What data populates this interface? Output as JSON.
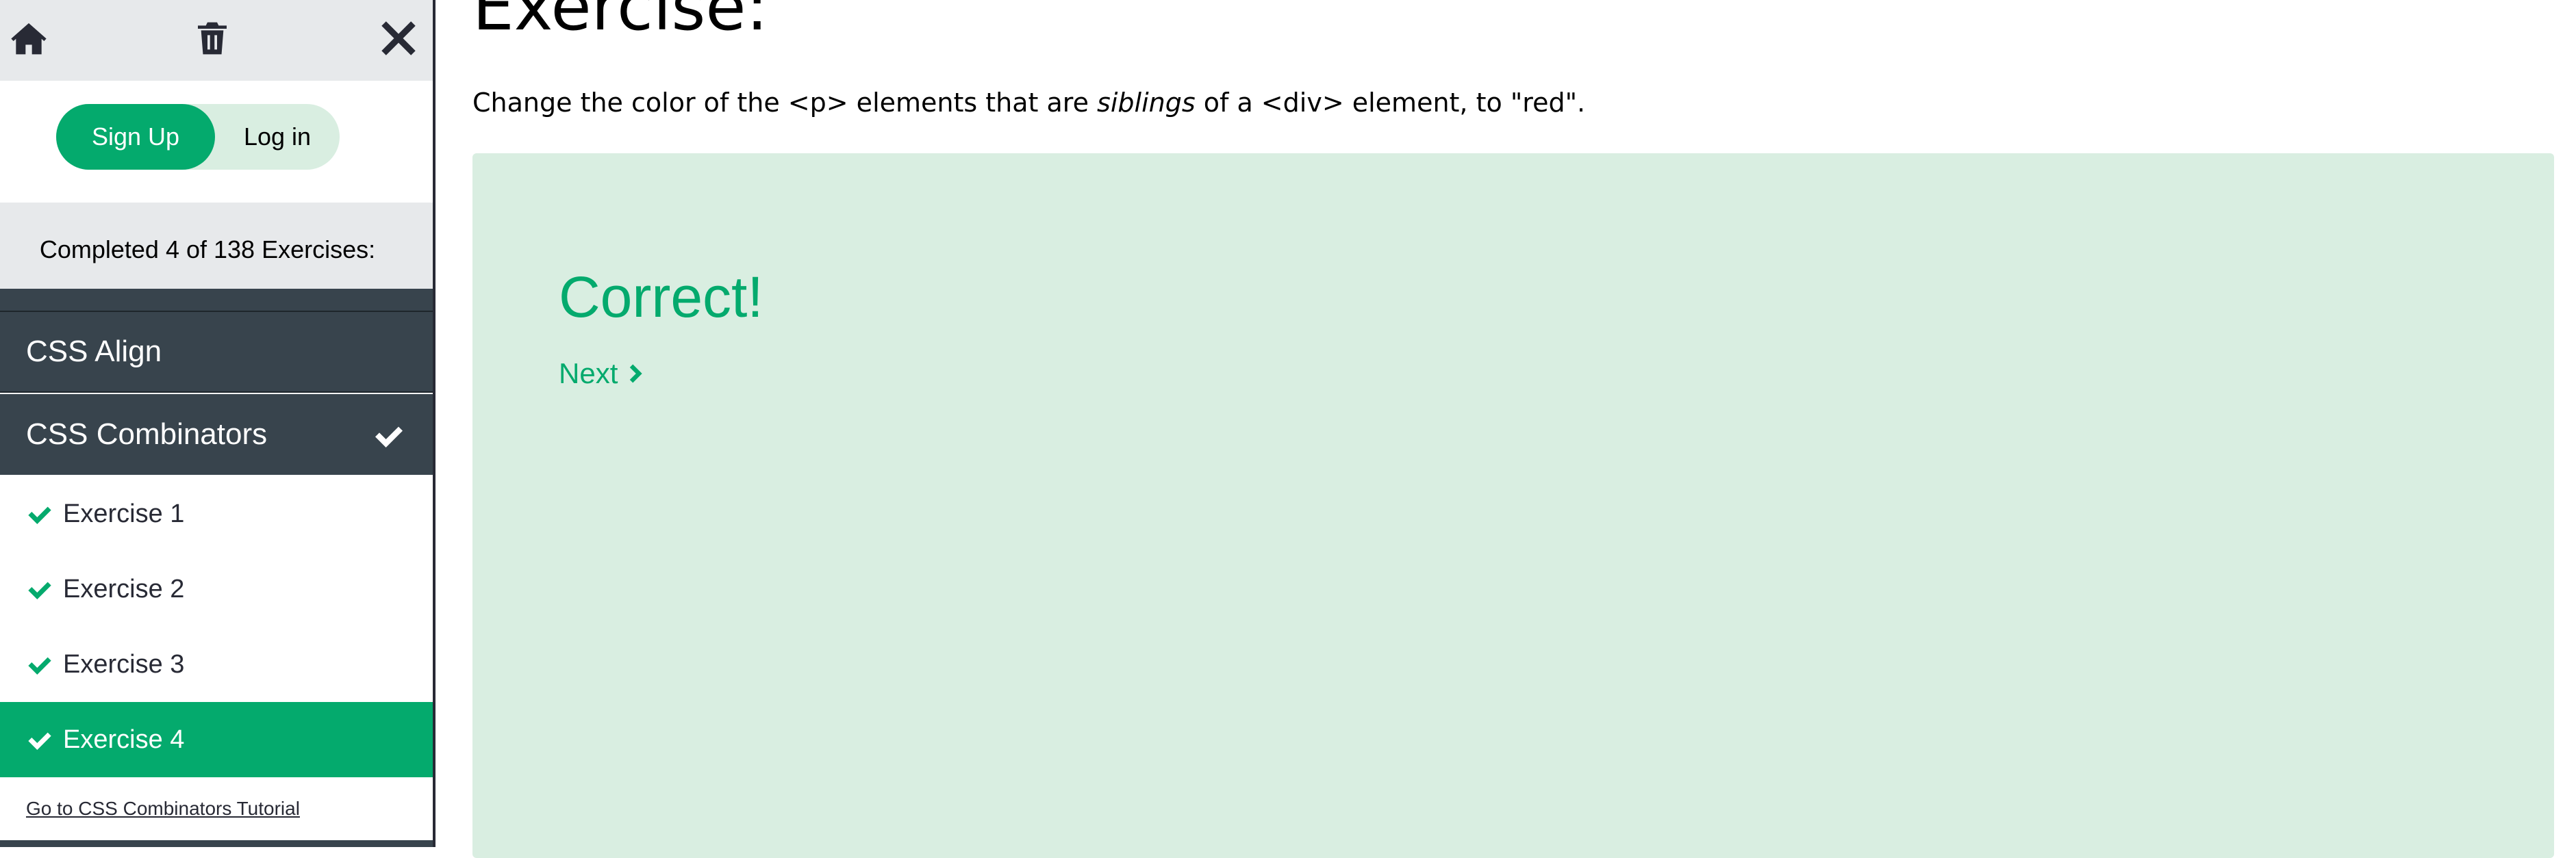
{
  "sidebar": {
    "icons": {
      "home": "home-icon",
      "trash": "trash-icon",
      "close": "close-icon"
    },
    "auth": {
      "signup_label": "Sign Up",
      "login_label": "Log in"
    },
    "progress_text": "Completed 4 of 138 Exercises:",
    "categories": [
      {
        "label": "CSS Align",
        "completed": false
      },
      {
        "label": "CSS Combinators",
        "completed": true
      }
    ],
    "exercises": [
      {
        "label": "Exercise 1",
        "completed": true,
        "active": false
      },
      {
        "label": "Exercise 2",
        "completed": true,
        "active": false
      },
      {
        "label": "Exercise 3",
        "completed": true,
        "active": false
      },
      {
        "label": "Exercise 4",
        "completed": true,
        "active": true
      }
    ],
    "tutorial_link": "Go to CSS Combinators Tutorial"
  },
  "main": {
    "heading": "Exercise:",
    "instruction": {
      "before": "Change the color of the <p> elements that are ",
      "emphasis": "siblings",
      "after": " of a <div> element, to \"red\"."
    },
    "result": {
      "title": "Correct!",
      "next_label": "Next"
    }
  },
  "colors": {
    "accent": "#04aa6d",
    "dark": "#282a35",
    "category_bg": "#38444d",
    "panel_bg": "#d9eee1",
    "light_bg": "#e7e9eb"
  }
}
